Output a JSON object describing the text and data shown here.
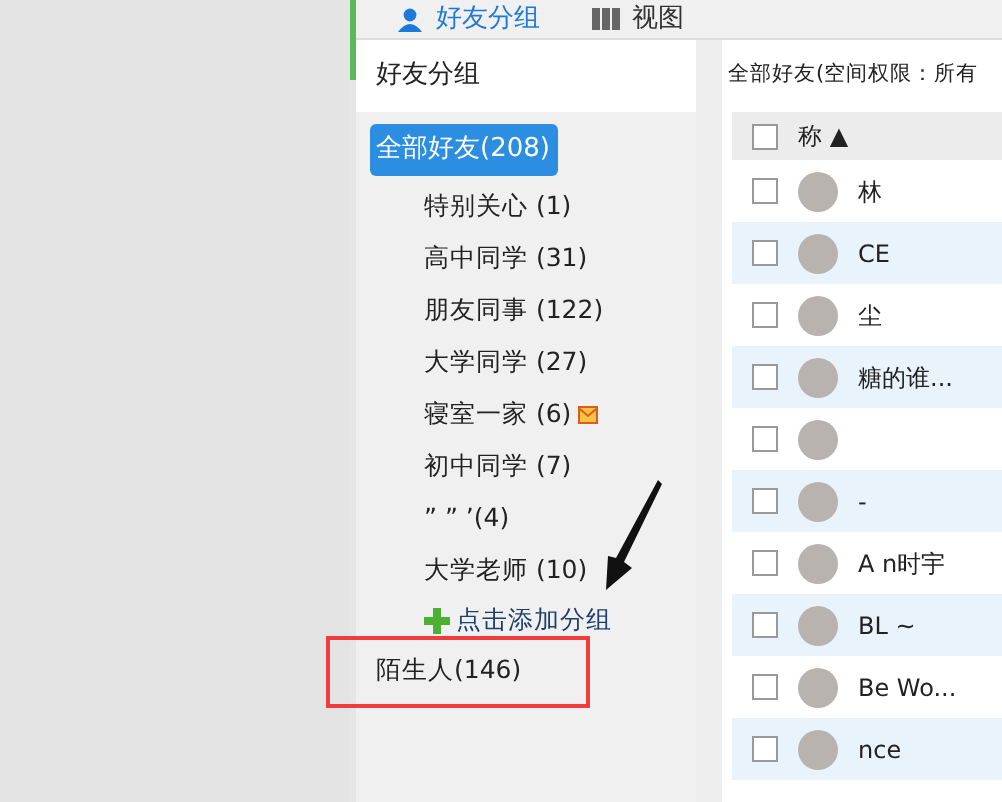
{
  "toolbar": {
    "tabs": [
      {
        "label": "好友分组",
        "selected": true
      },
      {
        "label": "视图",
        "selected": false
      }
    ]
  },
  "groups_panel": {
    "title": "好友分组",
    "groups": [
      {
        "label": "全部好友(208)",
        "selected": true,
        "message": false
      },
      {
        "label": "特别关心 (1)",
        "selected": false,
        "message": false
      },
      {
        "label": "高中同学 (31)",
        "selected": false,
        "message": false
      },
      {
        "label": "朋友同事 (122)",
        "selected": false,
        "message": false
      },
      {
        "label": "大学同学 (27)",
        "selected": false,
        "message": false
      },
      {
        "label": "寝室一家 (6)",
        "selected": false,
        "message": true
      },
      {
        "label": "初中同学 (7)",
        "selected": false,
        "message": false
      },
      {
        "label": "”   ”   ’(4)",
        "selected": false,
        "message": false
      },
      {
        "label": "大学老师 (10)",
        "selected": false,
        "message": false
      }
    ],
    "add_group": "点击添加分组",
    "strangers": "陌生人(146)"
  },
  "friends": {
    "title": "全部好友(空间权限：所有",
    "header": {
      "checked": false,
      "sort": "▲",
      "label": "称"
    },
    "rows": [
      {
        "checked": false,
        "name": "林"
      },
      {
        "checked": false,
        "name": "CE"
      },
      {
        "checked": false,
        "name": "尘"
      },
      {
        "checked": false,
        "name": "糖的谁..."
      },
      {
        "checked": false
      },
      {
        "checked": false,
        "name": "-"
      },
      {
        "checked": false,
        "name": "A    n时宇"
      },
      {
        "checked": false,
        "name": "BL    ~"
      },
      {
        "checked": false,
        "name": "Be    Wo..."
      },
      {
        "checked": false,
        "name": "nce"
      }
    ]
  },
  "callouts": {
    "highlight_box": true,
    "arrow": true
  }
}
